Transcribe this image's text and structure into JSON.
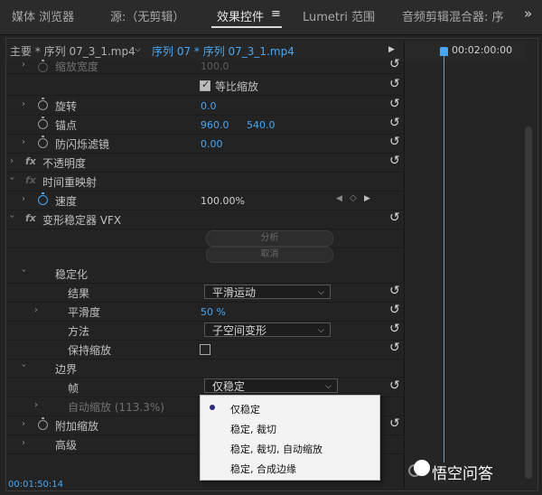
{
  "tabs": {
    "media_browser": "媒体 浏览器",
    "source": "源:（无剪辑）",
    "effect_controls": "效果控件",
    "effect_controls_menu": "≡",
    "lumetri": "Lumetri 范围",
    "audio_mixer": "音频剪辑混合器: 序",
    "more": "»"
  },
  "header": {
    "master_clip": "主要 * 序列 07_3_1.mp4",
    "sequence_clip": "序列 07 * 序列 07_3_1.mp4",
    "scroll_right": "▶",
    "timecode": "00:02:00:00"
  },
  "rows": {
    "scale_width": {
      "label": "缩放宽度",
      "value": "100.0"
    },
    "uniform_scale": {
      "label": "等比缩放"
    },
    "rotation": {
      "label": "旋转",
      "value": "0.0"
    },
    "anchor": {
      "label": "锚点",
      "x": "960.0",
      "y": "540.0"
    },
    "anti_flicker": {
      "label": "防闪烁滤镜",
      "value": "0.00"
    },
    "opacity": {
      "label": "不透明度"
    },
    "time_remap": {
      "label": "时间重映射"
    },
    "speed": {
      "label": "速度",
      "value": "100.00%"
    },
    "warp_stabilizer": {
      "label": "变形稳定器 VFX"
    },
    "analyze": {
      "label": "分析"
    },
    "cancel": {
      "label": "取消"
    },
    "stabilization": {
      "label": "稳定化"
    },
    "result": {
      "label": "结果",
      "value": "平滑运动"
    },
    "smoothness": {
      "label": "平滑度",
      "value": "50 %"
    },
    "method": {
      "label": "方法",
      "value": "子空间变形"
    },
    "preserve_scale": {
      "label": "保持缩放"
    },
    "borders": {
      "label": "边界"
    },
    "framing": {
      "label": "帧",
      "value": "仅稳定"
    },
    "auto_scale": {
      "label": "自动缩放 (113.3%)"
    },
    "additional_scale": {
      "label": "附加缩放"
    },
    "advanced": {
      "label": "高级"
    }
  },
  "framing_menu": {
    "options": [
      "仅稳定",
      "稳定, 裁切",
      "稳定, 裁切, 自动缩放",
      "稳定, 合成边缘"
    ],
    "selected": "仅稳定"
  },
  "footer": {
    "timecode": "00:01:50:14"
  },
  "watermark": {
    "text": "悟空问答"
  },
  "icons": {
    "reset": "↺",
    "keyframe_prev": "◀",
    "keyframe_add": "◇",
    "keyframe_next": "▶"
  },
  "colors": {
    "accent": "#4aa6f2",
    "panel_bg": "#232323",
    "popup_bg": "#f3f3f3"
  }
}
